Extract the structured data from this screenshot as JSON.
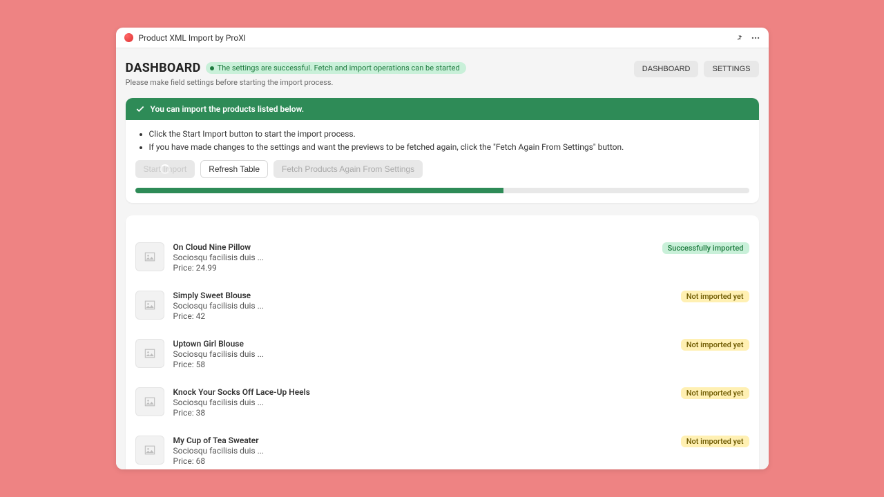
{
  "app_title": "Product XML Import by ProXI",
  "page": {
    "title": "DASHBOARD",
    "status_text": "The settings are successful. Fetch and import operations can be started",
    "subtitle": "Please make field settings before starting the import process."
  },
  "tabs": {
    "dashboard": "DASHBOARD",
    "settings": "SETTINGS"
  },
  "banner_text": "You can import the products listed below.",
  "instructions": [
    "Click the Start Import button to start the import process.",
    "If you have made changes to the settings and want the previews to be fetched again, click the \"Fetch Again From Settings\" button."
  ],
  "buttons": {
    "start_import": "Start Import",
    "refresh_table": "Refresh Table",
    "fetch_again": "Fetch Products Again From Settings"
  },
  "progress_percent": 60,
  "price_label": "Price: ",
  "status_labels": {
    "success": "Successfully imported",
    "pending": "Not imported yet"
  },
  "products": [
    {
      "title": "On Cloud Nine Pillow",
      "desc": "Sociosqu facilisis duis ...",
      "price": "24.99",
      "status": "success"
    },
    {
      "title": "Simply Sweet Blouse",
      "desc": "Sociosqu facilisis duis ...",
      "price": "42",
      "status": "pending"
    },
    {
      "title": "Uptown Girl Blouse",
      "desc": "Sociosqu facilisis duis ...",
      "price": "58",
      "status": "pending"
    },
    {
      "title": "Knock Your Socks Off Lace-Up Heels",
      "desc": "Sociosqu facilisis duis ...",
      "price": "38",
      "status": "pending"
    },
    {
      "title": "My Cup of Tea Sweater",
      "desc": "Sociosqu facilisis duis ...",
      "price": "68",
      "status": "pending"
    }
  ]
}
